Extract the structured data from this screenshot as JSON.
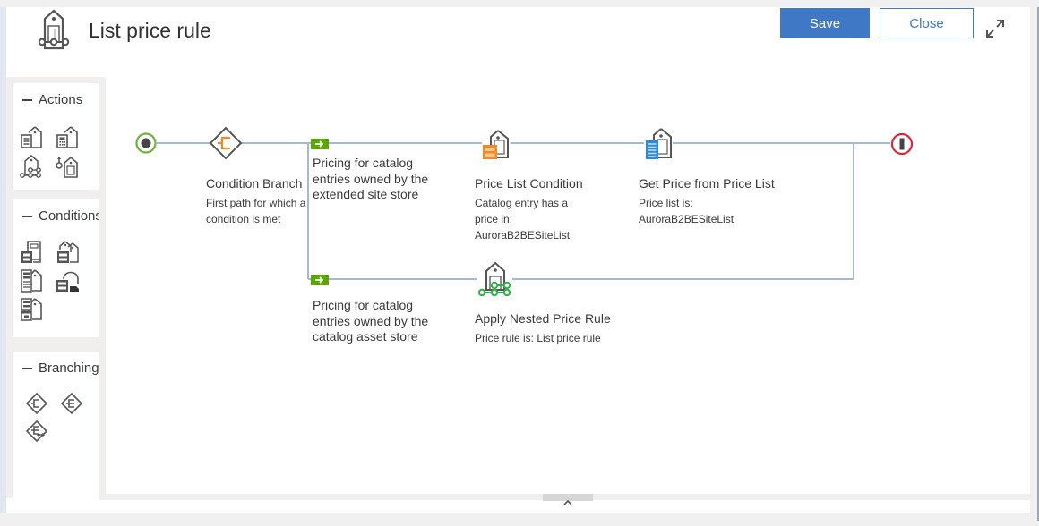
{
  "header": {
    "title": "List price rule",
    "title_icon": "price-rule-icon",
    "save_label": "Save",
    "close_label": "Close",
    "expand_icon": "expand-icon"
  },
  "palette": {
    "sections": [
      {
        "label": "Actions",
        "collapse_icon": "minus-icon",
        "items": [
          "price-list-action-icon",
          "calculation-code-icon",
          "nested-price-rule-icon",
          "price-adjustment-icon"
        ]
      },
      {
        "label": "Conditions",
        "collapse_icon": "minus-icon",
        "items": [
          "price-list-condition-icon",
          "catalog-entry-condition-icon",
          "catalog-entry-property-condition-icon",
          "customer-condition-icon",
          "date-condition-icon"
        ]
      },
      {
        "label": "Branching",
        "collapse_icon": "minus-icon",
        "items": [
          "condition-branch-icon",
          "exclusive-branch-icon",
          "compare-branch-icon"
        ]
      }
    ]
  },
  "flow": {
    "start_icon": "start-node-icon",
    "end_icon": "end-node-icon",
    "colors": {
      "connector": "#a7b7d6",
      "start": "#6fb33b",
      "end": "#d9283a",
      "path_marker": "#5aa700",
      "condition_accent": "#f08a24",
      "action_accent": "#2e8ad8",
      "nested_accent": "#33b04a"
    },
    "condition_branch": {
      "title": "Condition Branch",
      "description": "First path for which a condition is met"
    },
    "paths": [
      {
        "label": "Pricing for catalog entries owned by the extended site store",
        "nodes": [
          {
            "title": "Price List Condition",
            "description": "Catalog entry has a price in: AuroraB2BESiteList"
          },
          {
            "title": "Get Price from Price List",
            "description": "Price list is: AuroraB2BESiteList"
          }
        ]
      },
      {
        "label": "Pricing for catalog entries owned by the catalog asset store",
        "nodes": [
          {
            "title": "Apply Nested Price Rule",
            "description": "Price rule is: List price rule"
          }
        ]
      }
    ]
  },
  "footer": {
    "collapse_icon": "chevron-up-icon"
  }
}
